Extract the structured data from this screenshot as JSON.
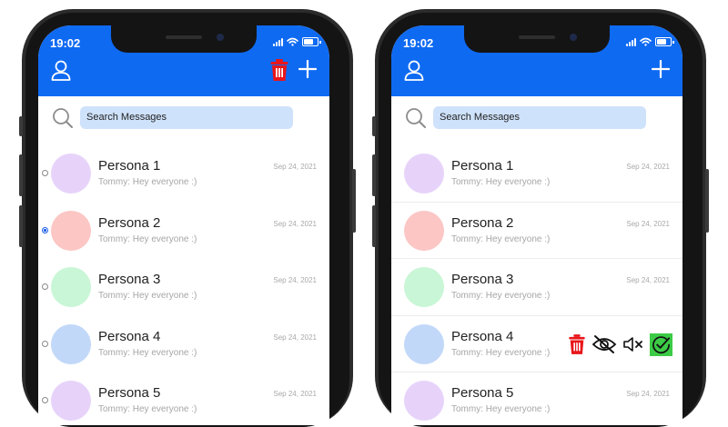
{
  "status_bar": {
    "time": "19:02"
  },
  "search": {
    "placeholder": "Search Messages"
  },
  "conversations": [
    {
      "name": "Persona 1",
      "preview": "Tommy: Hey everyone :)",
      "date": "Sep 24, 2021",
      "avatar_color": "#e7d3fa"
    },
    {
      "name": "Persona 2",
      "preview": "Tommy: Hey everyone :)",
      "date": "Sep 24, 2021",
      "avatar_color": "#fbc6c4"
    },
    {
      "name": "Persona 3",
      "preview": "Tommy: Hey everyone :)",
      "date": "Sep 24, 2021",
      "avatar_color": "#c8f6d6"
    },
    {
      "name": "Persona 4",
      "preview": "Tommy: Hey everyone :)",
      "date": "Sep 24, 2021",
      "avatar_color": "#c2d8f9"
    },
    {
      "name": "Persona 5",
      "preview": "Tommy: Hey everyone :)",
      "date": "Sep 24, 2021",
      "avatar_color": "#e7d3fa"
    }
  ],
  "colors": {
    "header": "#0f6af2",
    "search_field": "#cfe2fb",
    "delete": "#e8161a",
    "check_highlight": "#3ccb46"
  },
  "icons": {
    "header_left": "person-icon",
    "header_delete": "trash-icon",
    "header_add": "plus-icon",
    "search": "magnifier-icon",
    "row_actions": [
      "trash-icon",
      "eye-slash-icon",
      "mute-icon",
      "check-circle-icon"
    ]
  },
  "left_screen": {
    "mode": "selection",
    "selected_index": 1
  },
  "right_screen": {
    "mode": "swipe-actions",
    "swiped_index": 3
  }
}
